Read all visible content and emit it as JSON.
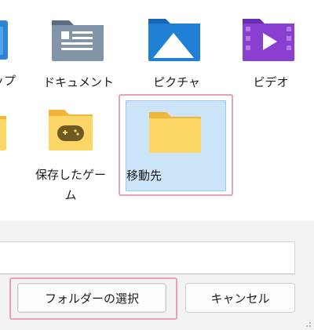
{
  "folders": [
    {
      "label": "ップ",
      "icon": "desktop-folder-icon"
    },
    {
      "label": "ドキュメント",
      "icon": "documents-folder-icon"
    },
    {
      "label": "ピクチャ",
      "icon": "pictures-folder-icon"
    },
    {
      "label": "ビデオ",
      "icon": "videos-folder-icon"
    },
    {
      "label": "",
      "icon": "folder-icon"
    },
    {
      "label_line1": "保存したゲー",
      "label_line2": "ム",
      "icon": "saved-games-folder-icon"
    },
    {
      "label": "移動先",
      "icon": "folder-icon",
      "selected": true
    }
  ],
  "path_input": {
    "value": ""
  },
  "buttons": {
    "select_folder": "フォルダーの選択",
    "cancel": "キャンセル"
  },
  "colors": {
    "selection_bg": "#cce4f7",
    "highlight": "#ec9ebb",
    "folder_yellow": "#f9c94a",
    "pictures_blue": "#1f7fd4",
    "videos_purple": "#8a3fd1"
  }
}
